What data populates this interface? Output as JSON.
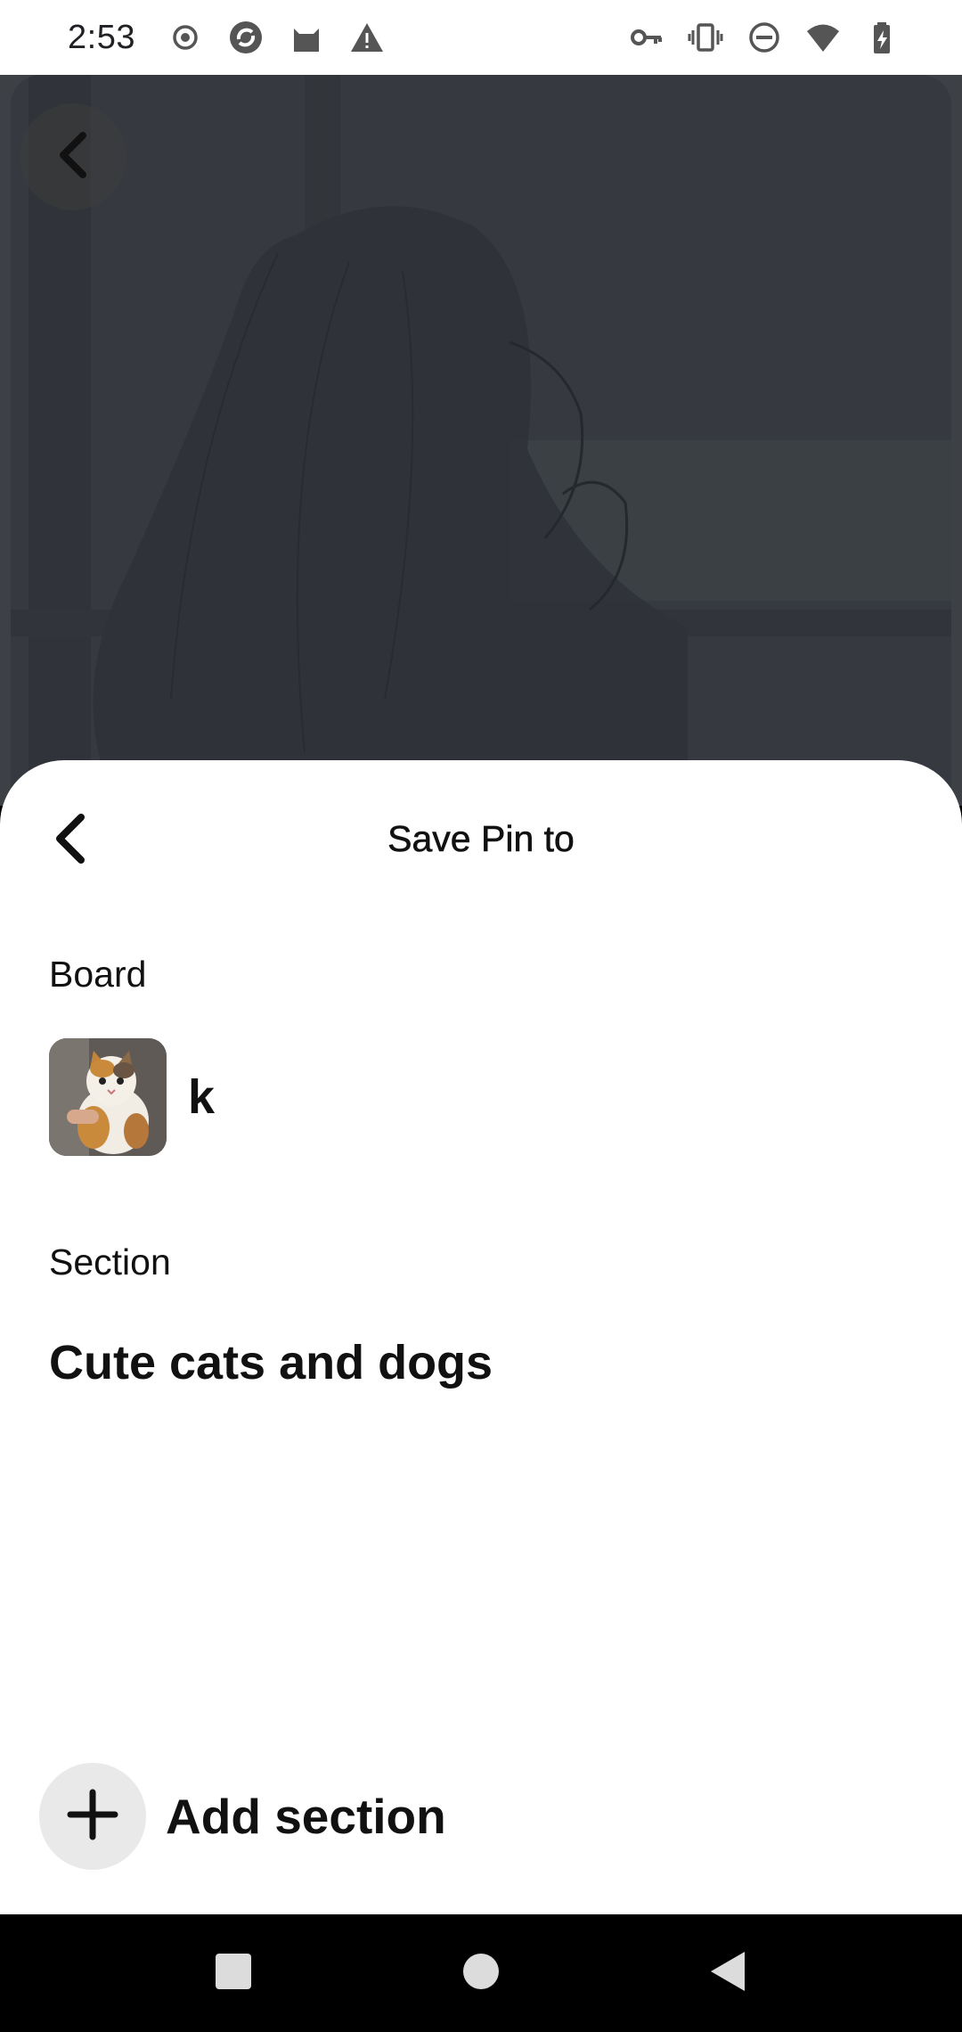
{
  "status_bar": {
    "time": "2:53",
    "left_icons": [
      "record-icon",
      "sync-icon",
      "cat-icon",
      "warning-icon"
    ],
    "right_icons": [
      "key-icon",
      "vibrate-icon",
      "dnd-icon",
      "wifi-icon",
      "battery-icon"
    ]
  },
  "pin": {
    "back_icon": "chevron-left-icon"
  },
  "sheet": {
    "title": "Save Pin to",
    "board_label": "Board",
    "board": {
      "name": "k"
    },
    "section_label": "Section",
    "section_item": "Cute cats and dogs",
    "add_section_label": "Add section"
  },
  "nav": {
    "buttons": [
      "recents-button",
      "home-button",
      "back-button"
    ]
  },
  "colors": {
    "sheet_bg": "#ffffff",
    "text": "#111111",
    "add_circle": "#e9e9e9",
    "nav_bg": "#000000"
  }
}
